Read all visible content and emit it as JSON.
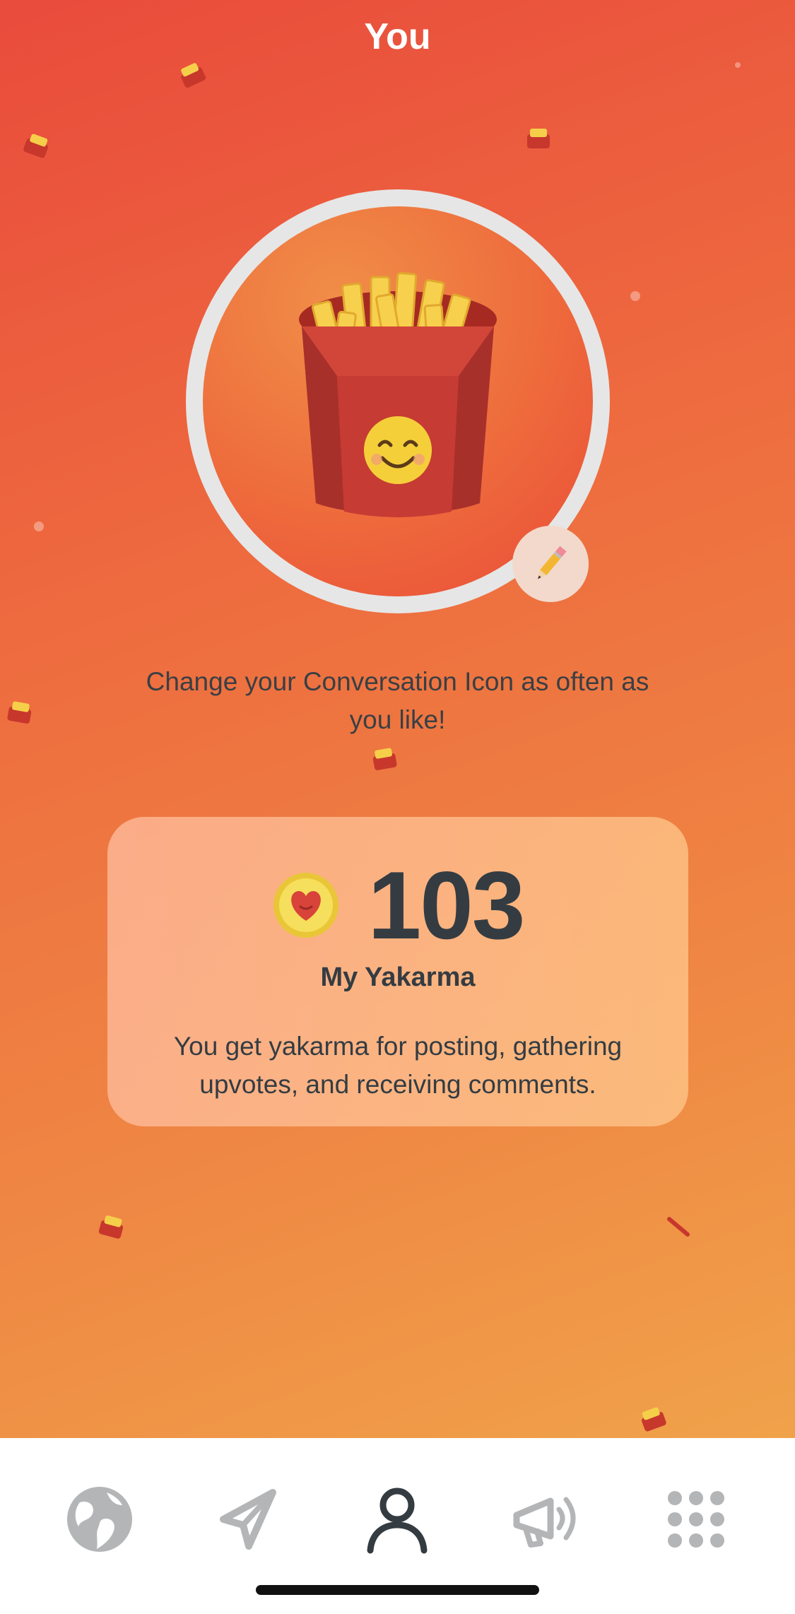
{
  "header": {
    "title": "You"
  },
  "avatar": {
    "icon": "french-fries-smiling-icon",
    "edit_icon": "pencil-icon"
  },
  "subtitle": "Change your Conversation Icon as often as you like!",
  "karma": {
    "icon": "heart-coin-icon",
    "value": "103",
    "label": "My Yakarma",
    "description": "You get yakarma for posting, gathering upvotes, and receiving comments."
  },
  "tabbar": {
    "items": [
      {
        "name": "globe-icon",
        "active": false
      },
      {
        "name": "send-icon",
        "active": false
      },
      {
        "name": "profile-icon",
        "active": true
      },
      {
        "name": "megaphone-icon",
        "active": false
      },
      {
        "name": "grid-icon",
        "active": false
      }
    ]
  },
  "colors": {
    "gradient_start": "#e94b3c",
    "gradient_end": "#f0a24a",
    "text_dark": "#343c42",
    "tab_inactive": "#b3b5b7",
    "tab_active": "#343c42"
  }
}
